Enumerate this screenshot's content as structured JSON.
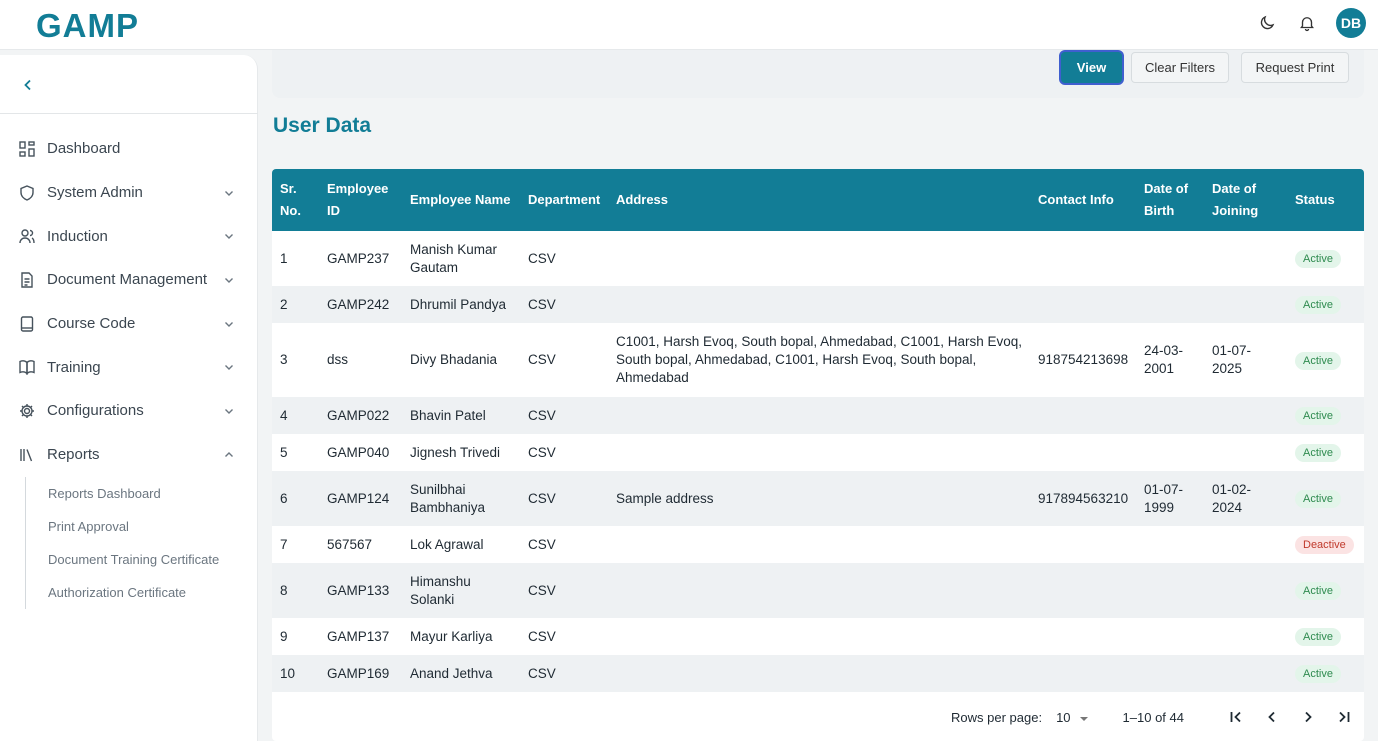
{
  "app": {
    "logo": "GAMP",
    "avatar_initials": "DB",
    "icons": [
      "moon-icon",
      "bell-icon"
    ]
  },
  "sidebar": {
    "items": [
      {
        "label": "Dashboard",
        "icon": "grid-icon",
        "has_chevron": false
      },
      {
        "label": "System Admin",
        "icon": "shield-icon",
        "has_chevron": true
      },
      {
        "label": "Induction",
        "icon": "users-icon",
        "has_chevron": true
      },
      {
        "label": "Document Management",
        "icon": "document-icon",
        "has_chevron": true
      },
      {
        "label": "Course Code",
        "icon": "tablet-icon",
        "has_chevron": true
      },
      {
        "label": "Training",
        "icon": "book-icon",
        "has_chevron": true
      },
      {
        "label": "Configurations",
        "icon": "gear-icon",
        "has_chevron": true
      },
      {
        "label": "Reports",
        "icon": "library-icon",
        "has_chevron": true,
        "expanded": true
      }
    ],
    "reports_sub": [
      "Reports Dashboard",
      "Print Approval",
      "Document Training Certificate",
      "Authorization Certificate"
    ]
  },
  "toolbar": {
    "view": "View",
    "clear_filters": "Clear Filters",
    "request_print": "Request Print"
  },
  "page_title": "User Data",
  "table": {
    "headers": [
      "Sr.\nNo.",
      "Employee\nID",
      "Employee Name",
      "Department",
      "Address",
      "Contact Info",
      "Date of\nBirth",
      "Date of\nJoining",
      "Status"
    ],
    "rows": [
      {
        "sr": "1",
        "id": "GAMP237",
        "name": "Manish Kumar Gautam",
        "dept": "CSV",
        "address": "",
        "contact": "",
        "dob": "",
        "doj": "",
        "status": "Active"
      },
      {
        "sr": "2",
        "id": "GAMP242",
        "name": "Dhrumil Pandya",
        "dept": "CSV",
        "address": "",
        "contact": "",
        "dob": "",
        "doj": "",
        "status": "Active"
      },
      {
        "sr": "3",
        "id": "dss",
        "name": "Divy Bhadania",
        "dept": "CSV",
        "address": "C1001, Harsh Evoq, South bopal, Ahmedabad, C1001, Harsh Evoq, South bopal, Ahmedabad, C1001, Harsh Evoq, South bopal, Ahmedabad",
        "contact": "918754213698",
        "dob": "24-03-2001",
        "doj": "01-07-2025",
        "status": "Active"
      },
      {
        "sr": "4",
        "id": "GAMP022",
        "name": "Bhavin Patel",
        "dept": "CSV",
        "address": "",
        "contact": "",
        "dob": "",
        "doj": "",
        "status": "Active"
      },
      {
        "sr": "5",
        "id": "GAMP040",
        "name": "Jignesh Trivedi",
        "dept": "CSV",
        "address": "",
        "contact": "",
        "dob": "",
        "doj": "",
        "status": "Active"
      },
      {
        "sr": "6",
        "id": "GAMP124",
        "name": "Sunilbhai Bambhaniya",
        "dept": "CSV",
        "address": "Sample address",
        "contact": "917894563210",
        "dob": "01-07-1999",
        "doj": "01-02-2024",
        "status": "Active"
      },
      {
        "sr": "7",
        "id": "567567",
        "name": "Lok Agrawal",
        "dept": "CSV",
        "address": "",
        "contact": "",
        "dob": "",
        "doj": "",
        "status": "Deactive"
      },
      {
        "sr": "8",
        "id": "GAMP133",
        "name": "Himanshu Solanki",
        "dept": "CSV",
        "address": "",
        "contact": "",
        "dob": "",
        "doj": "",
        "status": "Active"
      },
      {
        "sr": "9",
        "id": "GAMP137",
        "name": "Mayur Karliya",
        "dept": "CSV",
        "address": "",
        "contact": "",
        "dob": "",
        "doj": "",
        "status": "Active"
      },
      {
        "sr": "10",
        "id": "GAMP169",
        "name": "Anand Jethva",
        "dept": "CSV",
        "address": "",
        "contact": "",
        "dob": "",
        "doj": "",
        "status": "Active"
      }
    ]
  },
  "pager": {
    "rows_per_page_label": "Rows per page:",
    "rows_per_page": "10",
    "range": "1–10 of 44"
  },
  "colors": {
    "primary": "#127d96",
    "active_bg": "#e3f5ea",
    "active_text": "#2e8b4f",
    "deactive_bg": "#fbe3e3",
    "deactive_text": "#c0392b"
  }
}
